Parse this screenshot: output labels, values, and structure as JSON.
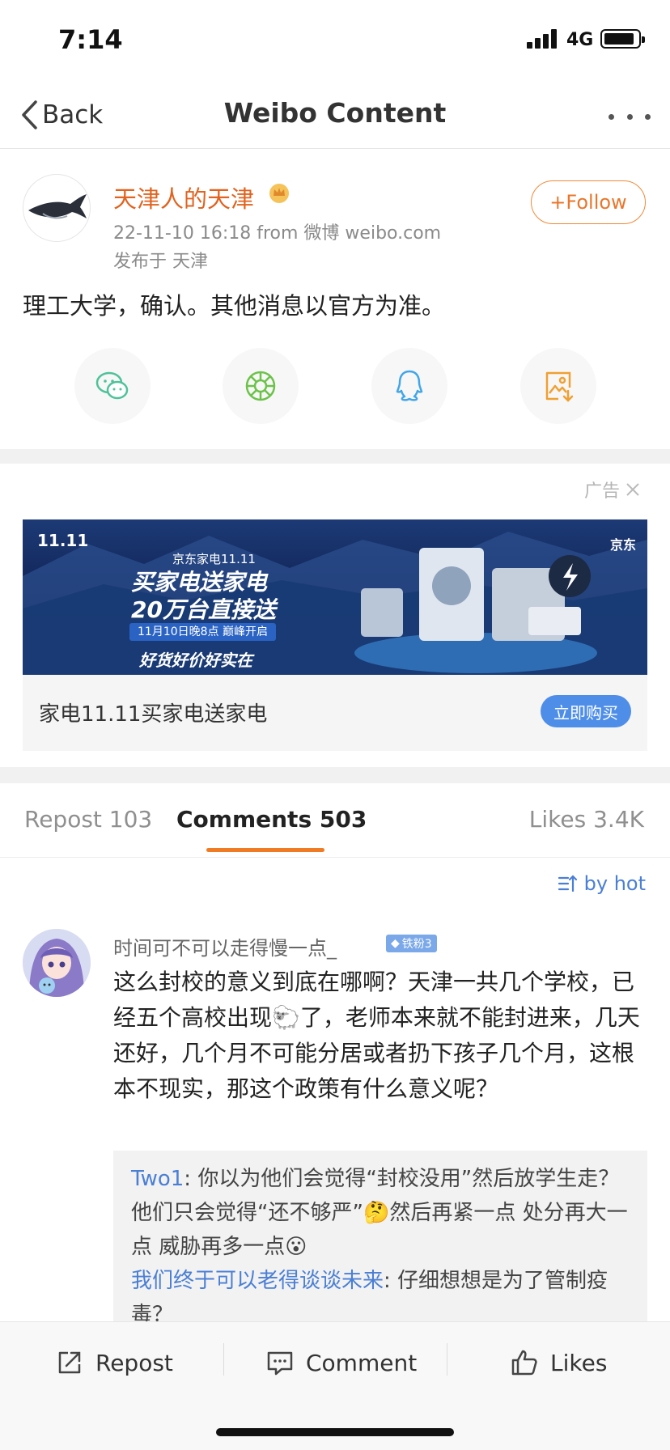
{
  "status_bar": {
    "time": "7:14",
    "network": "4G"
  },
  "nav": {
    "back_label": "Back",
    "title": "Weibo Content"
  },
  "post": {
    "author": "天津人的天津",
    "meta": "22-11-10 16:18  from 微博 weibo.com",
    "location": "发布于 天津",
    "follow_label": "+Follow",
    "text": "理工大学，确认。其他消息以官方为准。",
    "share_icons": [
      "wechat-icon",
      "moments-icon",
      "qq-icon",
      "save-image-icon"
    ]
  },
  "ad": {
    "tag": "广告",
    "banner": {
      "logo": "11.11",
      "brand": "京东",
      "line1": "京东家电11.11",
      "line2": "买家电送家电",
      "line3": "20万台直接送",
      "line4": "11月10日晚8点 巅峰开启",
      "line5": "好货好价好实在"
    },
    "caption": "家电11.11买家电送家电",
    "button": "立即购买"
  },
  "tabs": {
    "repost": "Repost 103",
    "comments": "Comments 503",
    "likes": "Likes 3.4K"
  },
  "sort_label": "by hot",
  "comment": {
    "user": "时间可不可以走得慢一点_",
    "badge": "铁粉3",
    "text": "这么封校的意义到底在哪啊？天津一共几个学校，已经五个高校出现🐑了，老师本来就不能封进来，几天还好，几个月不可能分居或者扔下孩子几个月，这根本不现实，那这个政策有什么意义呢？",
    "replies": [
      {
        "name": "Two1",
        "text": ": 你以为他们会觉得“封校没用”然后放学生走？他们只会觉得“还不够严”🤔然后再紧一点 处分再大一点 威胁再多一点😮"
      },
      {
        "name": "我们终于可以老得谈谈未来",
        "text": ": 仔细想想是为了管制疫毒？"
      }
    ]
  },
  "bottom_bar": {
    "repost": "Repost",
    "comment": "Comment",
    "likes": "Likes"
  },
  "colors": {
    "accent_orange": "#e9762a",
    "link_blue": "#4a7fd6",
    "ad_button": "#4e8ee8"
  }
}
